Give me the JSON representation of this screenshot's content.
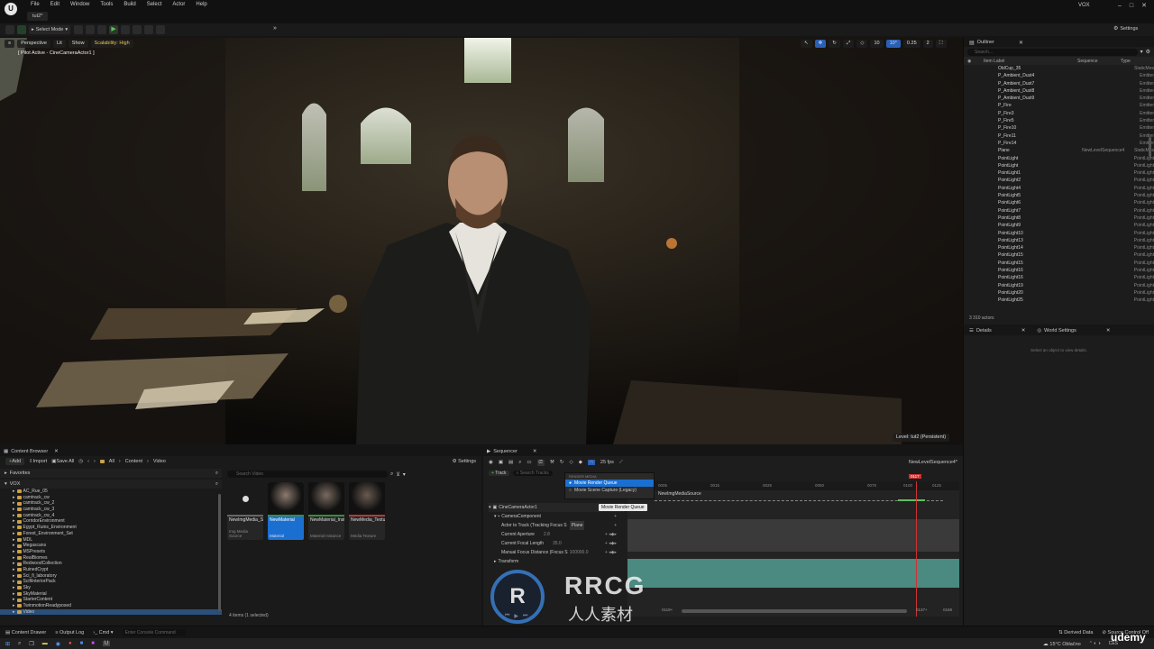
{
  "menubar": {
    "tab": "tut2*",
    "items": [
      "File",
      "Edit",
      "Window",
      "Tools",
      "Build",
      "Select",
      "Actor",
      "Help"
    ],
    "project": "VOX"
  },
  "toolbar": {
    "mode": "Select Mode",
    "settings": "Settings"
  },
  "viewport": {
    "perspective": "Perspective",
    "lit": "Lit",
    "show": "Show",
    "scalability": "Scalability: High",
    "pilot": "[ Pilot Active - CineCameraActor1 ]",
    "grid": "10",
    "angle": "10°",
    "scale": "0.25",
    "cams": "2",
    "level": "Level: tut2 (Persistent)"
  },
  "outliner": {
    "title": "Outliner",
    "search": "Search...",
    "col_label": "Item Label",
    "col_seq": "Sequence",
    "col_type": "Type",
    "rows": [
      {
        "name": "OldCup_35",
        "seq": "",
        "type": "StaticMes"
      },
      {
        "name": "P_Ambient_Dust4",
        "seq": "",
        "type": "Emitter"
      },
      {
        "name": "P_Ambient_Dust7",
        "seq": "",
        "type": "Emitter"
      },
      {
        "name": "P_Ambient_Dust8",
        "seq": "",
        "type": "Emitter"
      },
      {
        "name": "P_Ambient_Dust9",
        "seq": "",
        "type": "Emitter"
      },
      {
        "name": "P_Fire",
        "seq": "",
        "type": "Emitter"
      },
      {
        "name": "P_Fire3",
        "seq": "",
        "type": "Emitter"
      },
      {
        "name": "P_Fire5",
        "seq": "",
        "type": "Emitter"
      },
      {
        "name": "P_Fire10",
        "seq": "",
        "type": "Emitter"
      },
      {
        "name": "P_Fire11",
        "seq": "",
        "type": "Emitter"
      },
      {
        "name": "P_Fire14",
        "seq": "",
        "type": "Emitter"
      },
      {
        "name": "Plane",
        "seq": "NewLevelSequence4",
        "type": "StaticMes"
      },
      {
        "name": "PointLight",
        "seq": "",
        "type": "PointLight"
      },
      {
        "name": "PointLight",
        "seq": "",
        "type": "PointLight"
      },
      {
        "name": "PointLight1",
        "seq": "",
        "type": "PointLight"
      },
      {
        "name": "PointLight2",
        "seq": "",
        "type": "PointLight"
      },
      {
        "name": "PointLight4",
        "seq": "",
        "type": "PointLight"
      },
      {
        "name": "PointLight5",
        "seq": "",
        "type": "PointLight"
      },
      {
        "name": "PointLight6",
        "seq": "",
        "type": "PointLight"
      },
      {
        "name": "PointLight7",
        "seq": "",
        "type": "PointLight"
      },
      {
        "name": "PointLight8",
        "seq": "",
        "type": "PointLight"
      },
      {
        "name": "PointLight9",
        "seq": "",
        "type": "PointLight"
      },
      {
        "name": "PointLight10",
        "seq": "",
        "type": "PointLight"
      },
      {
        "name": "PointLight13",
        "seq": "",
        "type": "PointLight"
      },
      {
        "name": "PointLight14",
        "seq": "",
        "type": "PointLight"
      },
      {
        "name": "PointLight15",
        "seq": "",
        "type": "PointLight"
      },
      {
        "name": "PointLight15",
        "seq": "",
        "type": "PointLight"
      },
      {
        "name": "PointLight16",
        "seq": "",
        "type": "PointLight"
      },
      {
        "name": "PointLight16",
        "seq": "",
        "type": "PointLight"
      },
      {
        "name": "PointLight19",
        "seq": "",
        "type": "PointLight"
      },
      {
        "name": "PointLight20",
        "seq": "",
        "type": "PointLight"
      },
      {
        "name": "PointLight25",
        "seq": "",
        "type": "PointLight"
      }
    ],
    "count": "3 310 actors"
  },
  "details": {
    "title": "Details",
    "world": "World Settings",
    "hint": "Select an object to view details."
  },
  "content_browser": {
    "title": "Content Browser",
    "add": "Add",
    "import": "Import",
    "save_all": "Save All",
    "path": [
      "All",
      "Content",
      "Video"
    ],
    "settings": "Settings",
    "favorites": "Favorites",
    "root": "VOX",
    "search": "Search Video",
    "folders": [
      "AC_Rue_05",
      "camtrack_cw",
      "camtrack_cw_2",
      "camtrack_cw_3",
      "camtrack_cw_4",
      "CorridorEnvironment",
      "Egypt_Ruins_Environment",
      "Forest_Environment_Set",
      "MDL",
      "Megascans",
      "MSPresets",
      "RealBiomes",
      "RedwoodCollection",
      "RuinedCrypt",
      "Sci_fi_laboratory",
      "ScifiInteriorPack",
      "Sky",
      "SkyMaterial",
      "StarterContent",
      "TwinmotionReadyposed",
      "Video"
    ],
    "assets": [
      {
        "name": "NewImgMedia_Source",
        "type": "Img Media Source"
      },
      {
        "name": "NewMaterial",
        "type": "Material"
      },
      {
        "name": "NewMaterial_Inst",
        "type": "Material Instance"
      },
      {
        "name": "NewMedia_Texture",
        "type": "Media Texture"
      }
    ],
    "count": "4 items (1 selected)"
  },
  "sequencer": {
    "title": "Sequencer",
    "track": "Track",
    "search": "Search Tracks",
    "fps": "25 fps",
    "seq_name": "NewLevelSequence4*",
    "frame": "0117",
    "section_label": "NewImgMediaSource",
    "menu": {
      "header": "RENDER MEDIA",
      "item1": "Movie Render Queue",
      "item2": "Movie Scene Capture (Legacy)",
      "tooltip": "Movie Render Queue"
    },
    "rows": [
      {
        "label": "CineCameraActor1"
      },
      {
        "label": "CameraComponent"
      },
      {
        "label": "Actor to Track (Tracking Focus S",
        "val": "Plane"
      },
      {
        "label": "Current Aperture",
        "val": "2.8"
      },
      {
        "label": "Current Focal Length",
        "val": "35.0"
      },
      {
        "label": "Manual Focus Distance (Focus S",
        "val": "100000.0"
      },
      {
        "label": "Transform"
      }
    ],
    "ticks": [
      "0005",
      "0015",
      "0025",
      "0050",
      "0075",
      "0100",
      "0125"
    ],
    "end_frame": "0168",
    "cur_frame": "0137+",
    "start": "0119+"
  },
  "status": {
    "drawer": "Content Drawer",
    "output": "Output Log",
    "cmd": "Cmd",
    "console": "Enter Console Command",
    "derived": "Derived Data",
    "source_control": "Source Control Off"
  },
  "taskbar": {
    "weather": "15°C Oblačno",
    "lang": "CES"
  },
  "watermark": {
    "brand": "RRCG",
    "sub": "人人素材",
    "udemy": "udemy"
  }
}
